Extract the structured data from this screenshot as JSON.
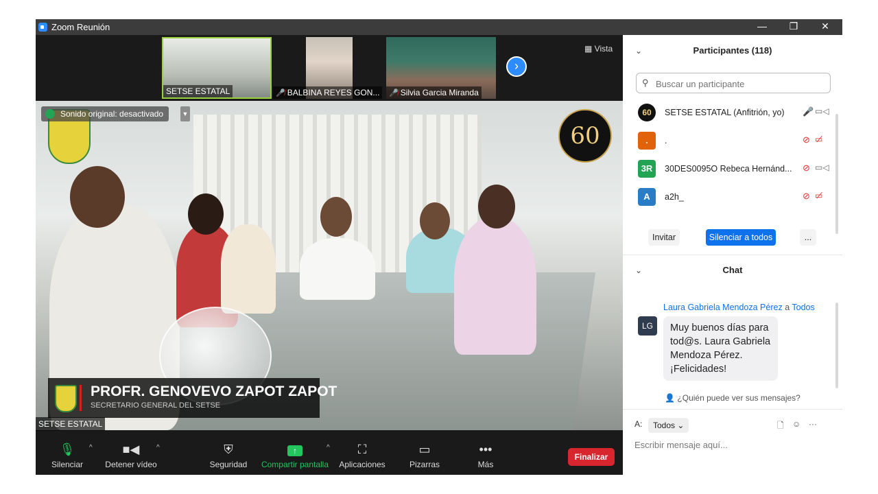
{
  "window": {
    "title": "Zoom Reunión",
    "min": "—",
    "restore": "❐",
    "close": "✕"
  },
  "video": {
    "thumbnails": [
      {
        "name": "SETSE ESTATAL",
        "muted": false
      },
      {
        "name": "BALBINA REYES GON...",
        "muted": true
      },
      {
        "name": "Silvia Garcia Miranda",
        "muted": true
      }
    ],
    "view_label": "Vista",
    "sound_notice": "Sonido original: desactivado",
    "logo_60": "60",
    "lower_third": {
      "name": "PROFR. GENOVEVO ZAPOT ZAPOT",
      "title": "SECRETARIO GENERAL DEL SETSE"
    },
    "self_name": "SETSE ESTATAL"
  },
  "toolbar": {
    "mute": "Silenciar",
    "video": "Detener vídeo",
    "security": "Seguridad",
    "share": "Compartir pantalla",
    "apps": "Aplicaciones",
    "whiteboards": "Pizarras",
    "more": "Más",
    "end": "Finalizar"
  },
  "participants": {
    "header": "Participantes (118)",
    "search_placeholder": "Buscar un participante",
    "list": [
      {
        "initials": "60",
        "name": "SETSE ESTATAL (Anfitrión, yo)",
        "color": "#111111"
      },
      {
        "initials": ".",
        "name": ".",
        "color": "#e0620b"
      },
      {
        "initials": "3R",
        "name": "30DES0095O  Rebeca Hernánd...",
        "color": "#23a455"
      },
      {
        "initials": "A",
        "name": "a2h_",
        "color": "#2a7cc7"
      }
    ],
    "invite": "Invitar",
    "mute_all": "Silenciar a todos",
    "more": "..."
  },
  "chat": {
    "header": "Chat",
    "sender": "Laura Gabriela Mendoza Pérez",
    "to_word": "a",
    "recipient": "Todos",
    "initials": "LG",
    "message": "Muy buenos días para tod@s. Laura Gabriela Mendoza Pérez. ¡Felicidades!",
    "who_can_see": "¿Quién puede ver sus mensajes?",
    "to_label": "A:",
    "to_value": "Todos",
    "input_placeholder": "Escribir mensaje aquí..."
  }
}
